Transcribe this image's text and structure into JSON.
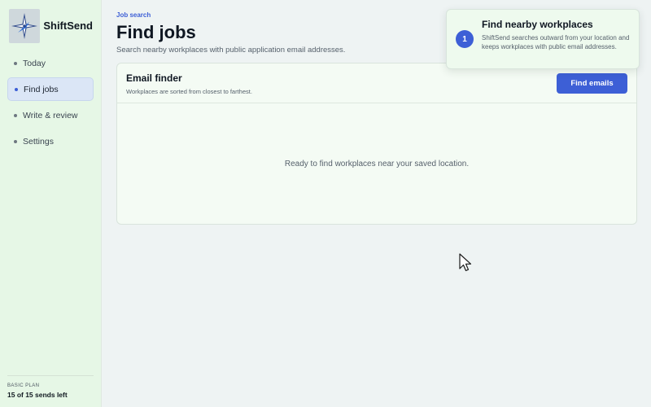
{
  "sidebar": {
    "brand": "ShiftSend",
    "items": [
      {
        "label": "Today",
        "active": false
      },
      {
        "label": "Find jobs",
        "active": true
      },
      {
        "label": "Write & review",
        "active": false
      },
      {
        "label": "Settings",
        "active": false
      }
    ],
    "plan": {
      "label": "BASIC PLAN",
      "count": "15 of 15 sends left"
    }
  },
  "header": {
    "eyebrow": "Job search",
    "title": "Find jobs",
    "subtitle": "Search nearby workplaces with public application email addresses."
  },
  "email_finder": {
    "title": "Email finder",
    "description": "Workplaces are sorted from closest to farthest.",
    "button_label": "Find emails",
    "empty_state": "Ready to find workplaces near your saved location."
  },
  "toast": {
    "step": "1",
    "title": "Find nearby workplaces",
    "body": "ShiftSend searches outward from your location and keeps workplaces with public email addresses."
  },
  "colors": {
    "accent": "#3d5fd6",
    "sidebar_bg": "#e6f7e6",
    "page_bg": "#eef3f3"
  },
  "icons": {
    "logo": "compass-star-icon",
    "cursor": "mouse-pointer-icon"
  }
}
